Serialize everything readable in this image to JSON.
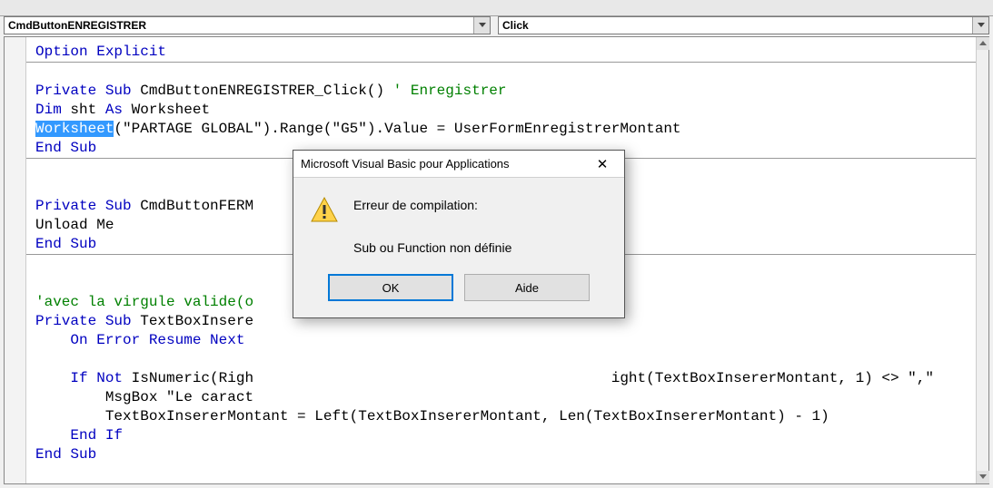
{
  "dropdowns": {
    "object": "CmdButtonENREGISTRER",
    "procedure": "Click"
  },
  "code": {
    "l1": "Option Explicit",
    "l2_a": "Private Sub",
    "l2_b": " CmdButtonENREGISTRER_Click() ",
    "l2_c": "' Enregistrer",
    "l3_a": "Dim",
    "l3_b": " sht ",
    "l3_c": "As",
    "l3_d": " Worksheet",
    "l4_hi": "Worksheet",
    "l4_rest": "(\"PARTAGE GLOBAL\").Range(\"G5\").Value = UserFormEnregistrerMontant",
    "l5": "End Sub",
    "l6_a": "Private Sub",
    "l6_b": " CmdButtonFERM",
    "l7": "Unload Me",
    "l8": "End Sub",
    "l9_a": "'avec la virgule valide(o",
    "l10_a": "Private Sub",
    "l10_b": " TextBoxInsere",
    "l11_a": "    On Error Resume Next",
    "l12_a": "    If Not",
    "l12_b": " IsNumeric(Righ",
    "l12_tail_a": "ight(TextBoxInsererMontant, 1) <> \",\"",
    "l13": "        MsgBox \"Le caract",
    "l14": "        TextBoxInsererMontant = Left(TextBoxInsererMontant, Len(TextBoxInsererMontant) - 1)",
    "l15": "    End If",
    "l16": "End Sub"
  },
  "dialog": {
    "title": "Microsoft Visual Basic pour Applications",
    "line1": "Erreur de compilation:",
    "line2": "Sub ou Function non définie",
    "ok": "OK",
    "help": "Aide"
  }
}
